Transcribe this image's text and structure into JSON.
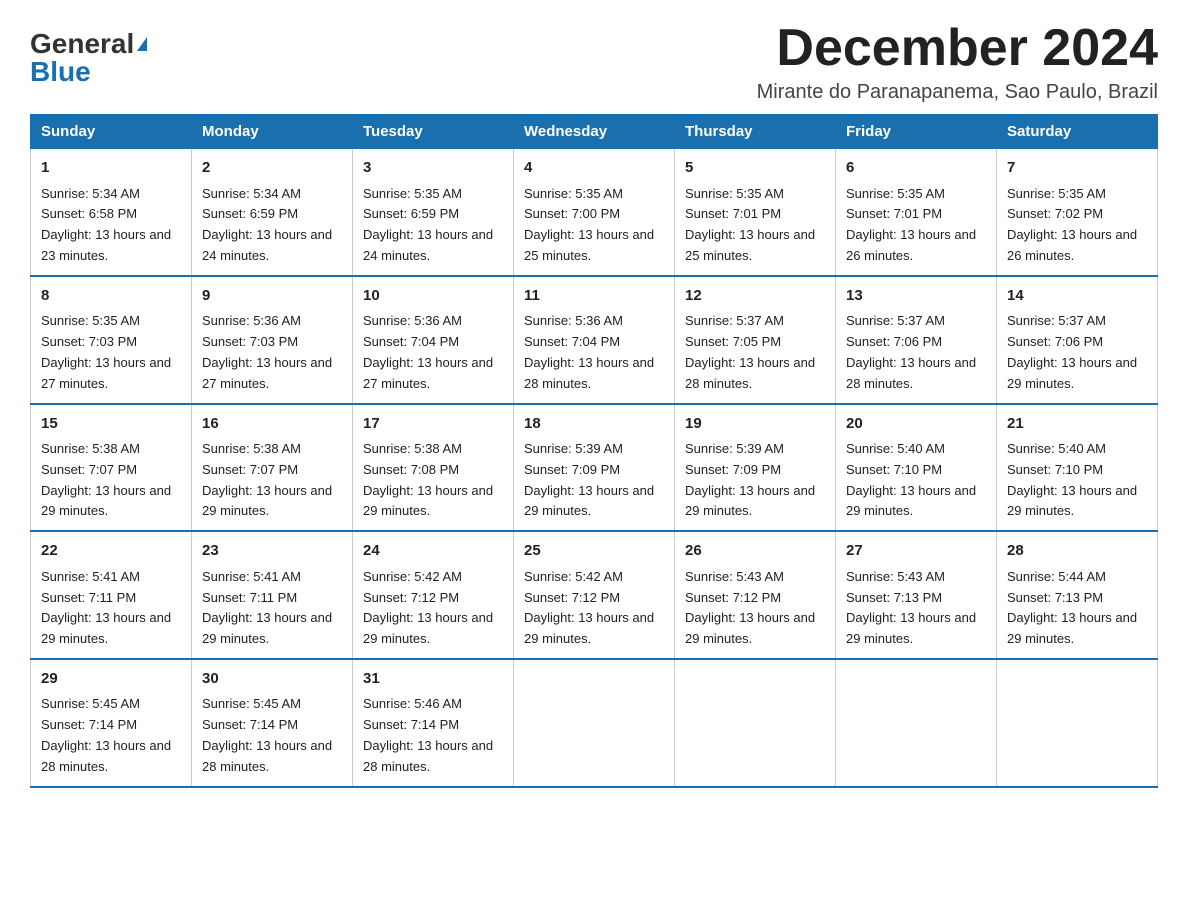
{
  "header": {
    "logo_general": "General",
    "logo_blue": "Blue",
    "month_title": "December 2024",
    "location": "Mirante do Paranapanema, Sao Paulo, Brazil"
  },
  "days_of_week": [
    "Sunday",
    "Monday",
    "Tuesday",
    "Wednesday",
    "Thursday",
    "Friday",
    "Saturday"
  ],
  "weeks": [
    [
      {
        "day": "1",
        "sunrise": "5:34 AM",
        "sunset": "6:58 PM",
        "daylight": "13 hours and 23 minutes."
      },
      {
        "day": "2",
        "sunrise": "5:34 AM",
        "sunset": "6:59 PM",
        "daylight": "13 hours and 24 minutes."
      },
      {
        "day": "3",
        "sunrise": "5:35 AM",
        "sunset": "6:59 PM",
        "daylight": "13 hours and 24 minutes."
      },
      {
        "day": "4",
        "sunrise": "5:35 AM",
        "sunset": "7:00 PM",
        "daylight": "13 hours and 25 minutes."
      },
      {
        "day": "5",
        "sunrise": "5:35 AM",
        "sunset": "7:01 PM",
        "daylight": "13 hours and 25 minutes."
      },
      {
        "day": "6",
        "sunrise": "5:35 AM",
        "sunset": "7:01 PM",
        "daylight": "13 hours and 26 minutes."
      },
      {
        "day": "7",
        "sunrise": "5:35 AM",
        "sunset": "7:02 PM",
        "daylight": "13 hours and 26 minutes."
      }
    ],
    [
      {
        "day": "8",
        "sunrise": "5:35 AM",
        "sunset": "7:03 PM",
        "daylight": "13 hours and 27 minutes."
      },
      {
        "day": "9",
        "sunrise": "5:36 AM",
        "sunset": "7:03 PM",
        "daylight": "13 hours and 27 minutes."
      },
      {
        "day": "10",
        "sunrise": "5:36 AM",
        "sunset": "7:04 PM",
        "daylight": "13 hours and 27 minutes."
      },
      {
        "day": "11",
        "sunrise": "5:36 AM",
        "sunset": "7:04 PM",
        "daylight": "13 hours and 28 minutes."
      },
      {
        "day": "12",
        "sunrise": "5:37 AM",
        "sunset": "7:05 PM",
        "daylight": "13 hours and 28 minutes."
      },
      {
        "day": "13",
        "sunrise": "5:37 AM",
        "sunset": "7:06 PM",
        "daylight": "13 hours and 28 minutes."
      },
      {
        "day": "14",
        "sunrise": "5:37 AM",
        "sunset": "7:06 PM",
        "daylight": "13 hours and 29 minutes."
      }
    ],
    [
      {
        "day": "15",
        "sunrise": "5:38 AM",
        "sunset": "7:07 PM",
        "daylight": "13 hours and 29 minutes."
      },
      {
        "day": "16",
        "sunrise": "5:38 AM",
        "sunset": "7:07 PM",
        "daylight": "13 hours and 29 minutes."
      },
      {
        "day": "17",
        "sunrise": "5:38 AM",
        "sunset": "7:08 PM",
        "daylight": "13 hours and 29 minutes."
      },
      {
        "day": "18",
        "sunrise": "5:39 AM",
        "sunset": "7:09 PM",
        "daylight": "13 hours and 29 minutes."
      },
      {
        "day": "19",
        "sunrise": "5:39 AM",
        "sunset": "7:09 PM",
        "daylight": "13 hours and 29 minutes."
      },
      {
        "day": "20",
        "sunrise": "5:40 AM",
        "sunset": "7:10 PM",
        "daylight": "13 hours and 29 minutes."
      },
      {
        "day": "21",
        "sunrise": "5:40 AM",
        "sunset": "7:10 PM",
        "daylight": "13 hours and 29 minutes."
      }
    ],
    [
      {
        "day": "22",
        "sunrise": "5:41 AM",
        "sunset": "7:11 PM",
        "daylight": "13 hours and 29 minutes."
      },
      {
        "day": "23",
        "sunrise": "5:41 AM",
        "sunset": "7:11 PM",
        "daylight": "13 hours and 29 minutes."
      },
      {
        "day": "24",
        "sunrise": "5:42 AM",
        "sunset": "7:12 PM",
        "daylight": "13 hours and 29 minutes."
      },
      {
        "day": "25",
        "sunrise": "5:42 AM",
        "sunset": "7:12 PM",
        "daylight": "13 hours and 29 minutes."
      },
      {
        "day": "26",
        "sunrise": "5:43 AM",
        "sunset": "7:12 PM",
        "daylight": "13 hours and 29 minutes."
      },
      {
        "day": "27",
        "sunrise": "5:43 AM",
        "sunset": "7:13 PM",
        "daylight": "13 hours and 29 minutes."
      },
      {
        "day": "28",
        "sunrise": "5:44 AM",
        "sunset": "7:13 PM",
        "daylight": "13 hours and 29 minutes."
      }
    ],
    [
      {
        "day": "29",
        "sunrise": "5:45 AM",
        "sunset": "7:14 PM",
        "daylight": "13 hours and 28 minutes."
      },
      {
        "day": "30",
        "sunrise": "5:45 AM",
        "sunset": "7:14 PM",
        "daylight": "13 hours and 28 minutes."
      },
      {
        "day": "31",
        "sunrise": "5:46 AM",
        "sunset": "7:14 PM",
        "daylight": "13 hours and 28 minutes."
      },
      null,
      null,
      null,
      null
    ]
  ]
}
